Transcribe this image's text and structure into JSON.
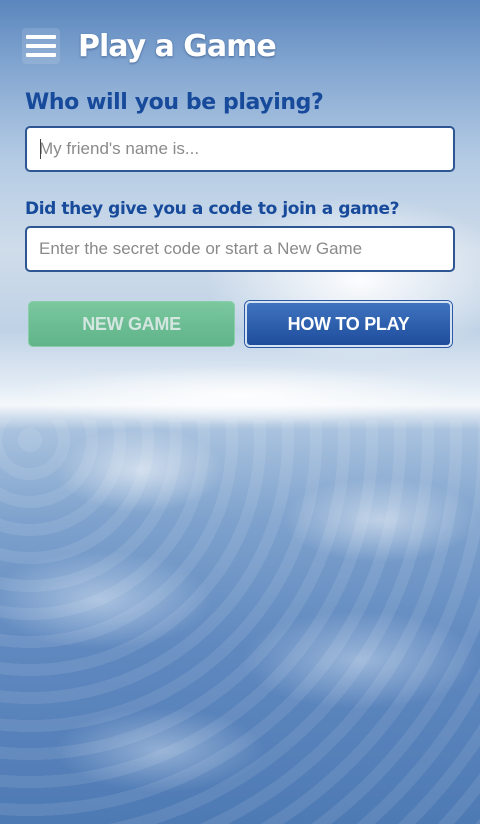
{
  "app": {
    "title": "Play a Game"
  },
  "form": {
    "name_label": "Who will you be playing?",
    "name_placeholder": "My friend's name is...",
    "code_label": "Did they give you a code to join a game?",
    "code_placeholder": "Enter the secret code or start a New Game"
  },
  "buttons": {
    "new_game": "NEW GAME",
    "how_to_play": "HOW TO PLAY"
  },
  "icons": {
    "menu": "hamburger-menu-icon"
  },
  "colors": {
    "label": "#174a9a",
    "field_border": "#2d5692",
    "new_game_bg": "#5bb883",
    "how_to_play_bg": "#2a5eae"
  },
  "state": {
    "new_game_enabled": false
  }
}
